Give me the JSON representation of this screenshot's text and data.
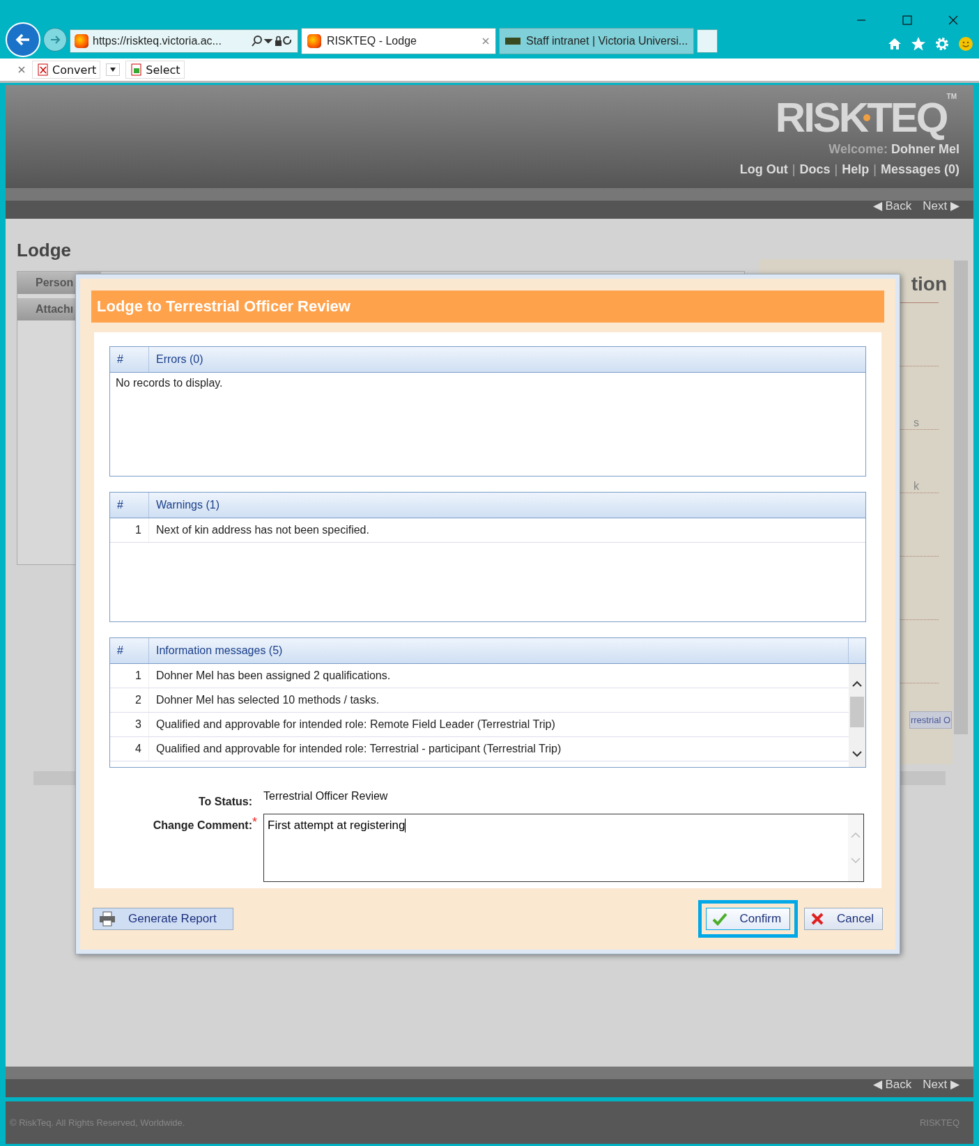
{
  "browser": {
    "address": "https://riskteq.victoria.ac...",
    "tabs": [
      {
        "label": "RISKTEQ - Lodge",
        "selected": true
      },
      {
        "label": "Staff intranet | Victoria Universi...",
        "selected": false
      }
    ],
    "toolbar": [
      "Convert",
      "Select"
    ]
  },
  "header": {
    "logo": "RISKTEQ",
    "trademark": "TM",
    "welcome_label": "Welcome:",
    "user": "Dohner Mel",
    "separator": "|",
    "links": [
      "Log Out",
      "Docs",
      "Help",
      "Messages (0)"
    ]
  },
  "nav": {
    "back": "◀ Back",
    "next": "Next ▶"
  },
  "page": {
    "title": "Lodge",
    "tabs": [
      "Person",
      "Attachı"
    ],
    "side_title": "tion",
    "side_items": [
      "s",
      "k"
    ],
    "side_button": "rrestrial O"
  },
  "dialog": {
    "title": "Lodge to Terrestrial Officer Review",
    "sections": [
      {
        "number_header": "#",
        "title": "Errors (0)",
        "empty_text": "No records to display.",
        "scrollable": false
      },
      {
        "number_header": "#",
        "title": "Warnings (1)",
        "rows": [
          {
            "number": "1",
            "text": "Next of kin address has not been specified."
          }
        ],
        "scrollable": false
      },
      {
        "number_header": "#",
        "title": "Information messages (5)",
        "scrollable": true,
        "rows": [
          {
            "number": "1",
            "text": "Dohner Mel has been assigned 2 qualifications."
          },
          {
            "number": "2",
            "text": "Dohner Mel has selected 10 methods / tasks."
          },
          {
            "number": "3",
            "text": "Qualified and approvable for intended role: Remote Field Leader (Terrestrial Trip)"
          },
          {
            "number": "4",
            "text": "Qualified and approvable for intended role: Terrestrial - participant (Terrestrial Trip)"
          }
        ]
      }
    ],
    "to_status_label": "To Status:",
    "to_status": "Terrestrial Officer Review",
    "comment_label": "Change Comment:",
    "required_mark": "*",
    "comment": "First attempt at registering",
    "report_button": "Generate Report",
    "actions": [
      {
        "kind": "confirm",
        "label": "Confirm",
        "focused": true
      },
      {
        "kind": "cancel",
        "label": "Cancel",
        "focused": false
      }
    ]
  },
  "footer": {
    "nav_back": "◀ Back",
    "nav_next": "Next ▶",
    "copyright": "© RiskTeq. All Rights Reserved, Worldwide.",
    "brand": "RISKTEQ"
  }
}
